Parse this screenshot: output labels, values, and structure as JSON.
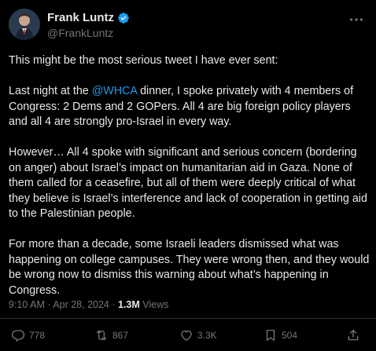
{
  "author": {
    "name": "Frank Luntz",
    "handle": "@FrankLuntz"
  },
  "tweet": {
    "p1": "This might be the most serious tweet I have ever sent:",
    "p2_before": "Last night at the ",
    "p2_mention": "@WHCA",
    "p2_after": " dinner, I spoke privately with 4 members of Congress: 2 Dems and 2 GOPers.  All 4 are big foreign policy players and all 4 are strongly pro-Israel in every way.",
    "p3": "However… All 4 spoke with significant and serious concern (bordering on anger) about Israel’s impact on humanitarian aid in Gaza.  None of them called for a ceasefire, but all of them were deeply critical of what they believe is Israel’s interference and lack of cooperation in getting aid to the Palestinian people.",
    "p4": "For more than a decade, some Israeli leaders dismissed what was happening on college campuses.  They were wrong then, and they would be wrong now to dismiss this warning about what’s happening in Congress."
  },
  "meta": {
    "time": "9:10 AM",
    "sep": " · ",
    "date": "Apr 28, 2024",
    "sep2": " · ",
    "views_count": "1.3M",
    "views_label": " Views"
  },
  "actions": {
    "replies": "778",
    "reposts": "867",
    "likes": "3.3K",
    "bookmarks": "504"
  },
  "colors": {
    "background": "#000000",
    "text": "#e7e9ea",
    "secondary": "#71767b",
    "accent": "#1d9bf0"
  },
  "icons": [
    "avatar",
    "verified-badge-icon",
    "more-options-icon",
    "reply-icon",
    "repost-icon",
    "like-icon",
    "bookmark-icon",
    "share-icon"
  ]
}
